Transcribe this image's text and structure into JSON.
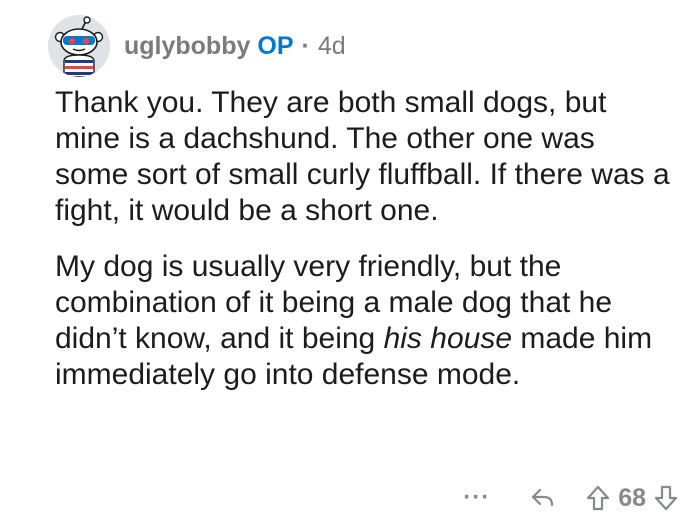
{
  "comment": {
    "author": "uglybobby",
    "op_badge": "OP",
    "separator": "·",
    "age": "4d",
    "paragraphs": {
      "p1": "Thank you. They are both small dogs, but mine is a dachshund. The other one was some sort of small curly fluffball. If there was a fight, it would be a short one.",
      "p2_before": "My dog is usually very friendly, but the combination of it being a male dog that he didn’t know, and it being ",
      "p2_italic": "his house",
      "p2_after": " made him immediately go into defense mode."
    },
    "actions": {
      "more_label": "···",
      "score": "68"
    }
  },
  "icons": {
    "avatar": "snoo-avatar-icon",
    "reply": "reply-icon",
    "upvote": "upvote-arrow-icon",
    "downvote": "downvote-arrow-icon"
  },
  "colors": {
    "op_badge": "#0079d3",
    "meta_text": "#787c7e",
    "body_text": "#1c1c1c",
    "action_gray": "#878a8c"
  }
}
